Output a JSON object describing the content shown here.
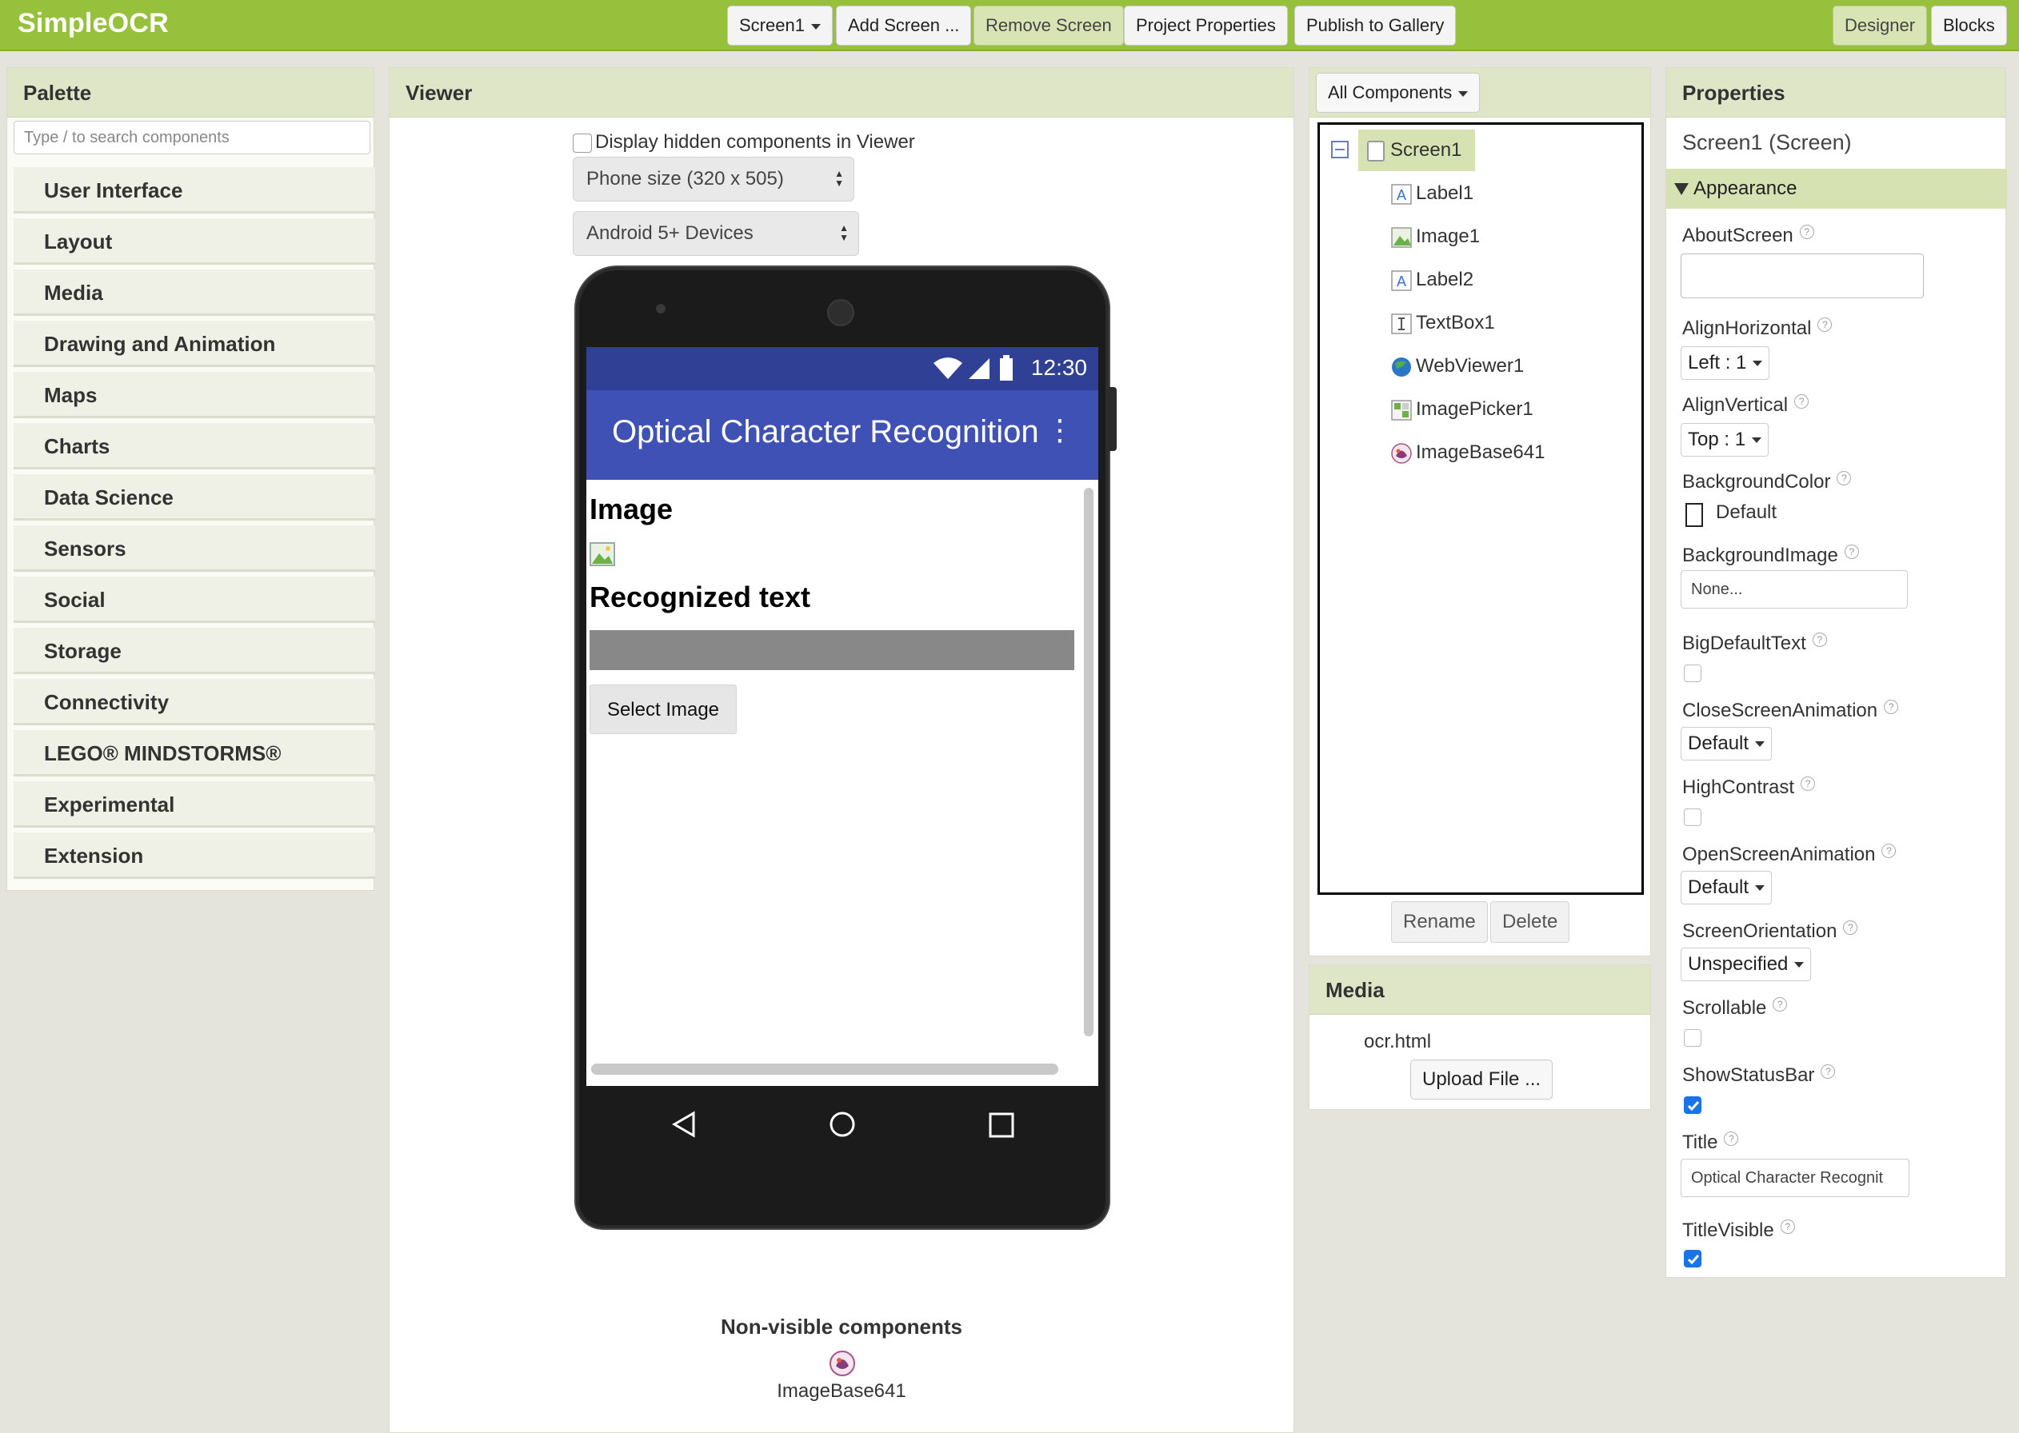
{
  "app": {
    "title": "SimpleOCR"
  },
  "toolbar": {
    "screen_select": "Screen1",
    "add_screen": "Add Screen ...",
    "remove_screen": "Remove Screen",
    "project_properties": "Project Properties",
    "publish": "Publish to Gallery",
    "designer": "Designer",
    "blocks": "Blocks"
  },
  "palette": {
    "header": "Palette",
    "search_placeholder": "Type / to search components",
    "categories": [
      "User Interface",
      "Layout",
      "Media",
      "Drawing and Animation",
      "Maps",
      "Charts",
      "Data Science",
      "Sensors",
      "Social",
      "Storage",
      "Connectivity",
      "LEGO® MINDSTORMS®",
      "Experimental",
      "Extension"
    ]
  },
  "viewer": {
    "header": "Viewer",
    "hidden_checkbox_label": "Display hidden components in Viewer",
    "size_select": "Phone size (320 x 505)",
    "device_select": "Android 5+ Devices",
    "phone": {
      "clock": "12:30",
      "title": "Optical Character Recognition",
      "label1": "Image",
      "label2": "Recognized text",
      "button": "Select Image"
    },
    "nonvisible_title": "Non-visible components",
    "nonvisible_items": [
      "ImageBase641"
    ]
  },
  "components": {
    "filter": "All Components",
    "tree": {
      "root": "Screen1",
      "children": [
        {
          "name": "Label1",
          "icon": "label-icon"
        },
        {
          "name": "Image1",
          "icon": "image-icon"
        },
        {
          "name": "Label2",
          "icon": "label-icon"
        },
        {
          "name": "TextBox1",
          "icon": "textbox-icon"
        },
        {
          "name": "WebViewer1",
          "icon": "webviewer-icon"
        },
        {
          "name": "ImagePicker1",
          "icon": "imagepicker-icon"
        },
        {
          "name": "ImageBase641",
          "icon": "extension-icon"
        }
      ]
    },
    "rename": "Rename",
    "delete": "Delete"
  },
  "media": {
    "header": "Media",
    "files": [
      "ocr.html"
    ],
    "upload": "Upload File ..."
  },
  "properties": {
    "header": "Properties",
    "screen_name": "Screen1 (Screen)",
    "section": "Appearance",
    "about_screen": {
      "label": "AboutScreen",
      "value": ""
    },
    "align_horizontal": {
      "label": "AlignHorizontal",
      "value": "Left : 1"
    },
    "align_vertical": {
      "label": "AlignVertical",
      "value": "Top : 1"
    },
    "background_color": {
      "label": "BackgroundColor",
      "value": "Default"
    },
    "background_image": {
      "label": "BackgroundImage",
      "value": "None..."
    },
    "big_default_text": {
      "label": "BigDefaultText",
      "checked": false
    },
    "close_screen_animation": {
      "label": "CloseScreenAnimation",
      "value": "Default"
    },
    "high_contrast": {
      "label": "HighContrast",
      "checked": false
    },
    "open_screen_animation": {
      "label": "OpenScreenAnimation",
      "value": "Default"
    },
    "screen_orientation": {
      "label": "ScreenOrientation",
      "value": "Unspecified"
    },
    "scrollable": {
      "label": "Scrollable",
      "checked": false
    },
    "show_status_bar": {
      "label": "ShowStatusBar",
      "checked": true
    },
    "title": {
      "label": "Title",
      "value": "Optical Character Recognit"
    },
    "title_visible": {
      "label": "TitleVisible",
      "checked": true
    },
    "help_glyph": "?"
  },
  "colors": {
    "topbar": "#97c03c",
    "panel_header": "#dfe6c8",
    "phone_status": "#304095",
    "phone_titlebar": "#3f51b5",
    "checkbox_checked": "#1a73e8"
  }
}
